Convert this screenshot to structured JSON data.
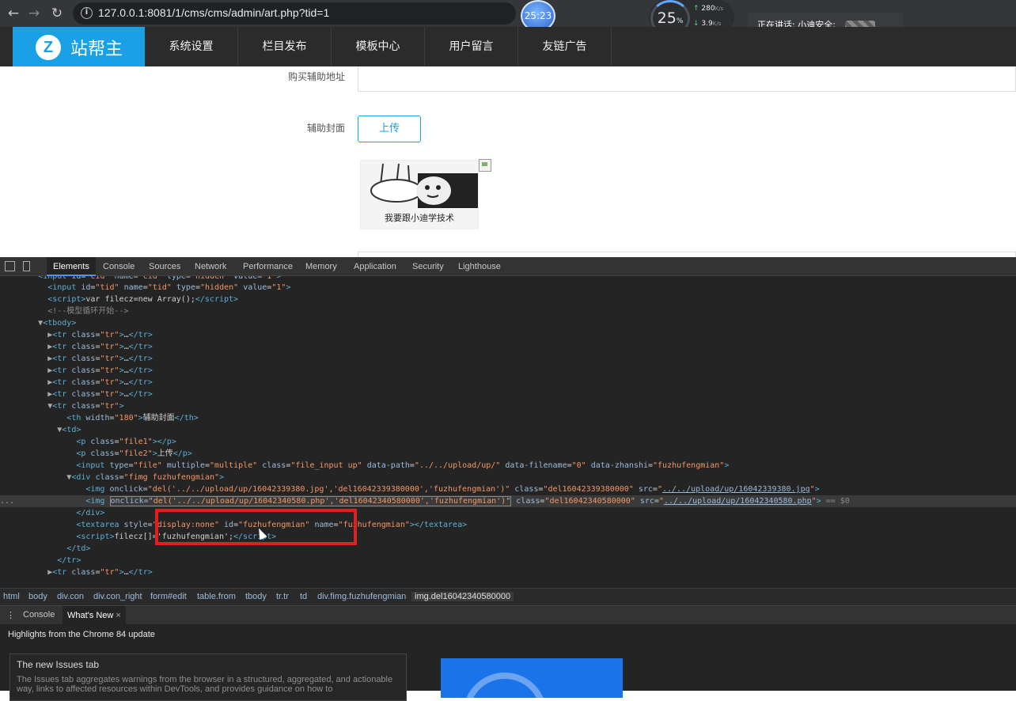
{
  "browser": {
    "url": "127.0.0.1:8081/1/cms/cms/admin/art.php?tid=1",
    "timer": "25:23",
    "net_percent": "25",
    "net_percent_unit": "%",
    "upload_speed": "280",
    "download_speed": "3.9",
    "speed_unit": "K/s",
    "speaking": "正在讲话: 小迪安全;"
  },
  "cms": {
    "logo_letter": "Z",
    "logo_text": "站帮主",
    "nav": [
      "系统设置",
      "栏目发布",
      "模板中心",
      "用户留言",
      "友链广告"
    ]
  },
  "form": {
    "buy_label": "购买辅助地址",
    "cover_label": "辅助封面",
    "upload_button": "上传",
    "thumb_caption": "我要跟小迪学技术"
  },
  "devtools": {
    "tabs": [
      "Elements",
      "Console",
      "Sources",
      "Network",
      "Performance",
      "Memory",
      "Application",
      "Security",
      "Lighthouse"
    ],
    "active_tab": "Elements",
    "breadcrumb": [
      "html",
      "body",
      "div.con",
      "div.con_right",
      "form#edit",
      "table.from",
      "tbody",
      "tr.tr",
      "td",
      "div.fimg.fuzhufengmian",
      "img.del16042340580000"
    ],
    "drawer_tabs": [
      "Console",
      "What's New"
    ],
    "drawer_active": "What's New",
    "highlights": "Highlights from the Chrome 84 update",
    "card_title": "The new Issues tab",
    "card_body": "The Issues tab aggregates warnings from the browser in a structured, aggregated, and actionable way, links to affected resources within DevTools, and provides guidance on how to"
  }
}
